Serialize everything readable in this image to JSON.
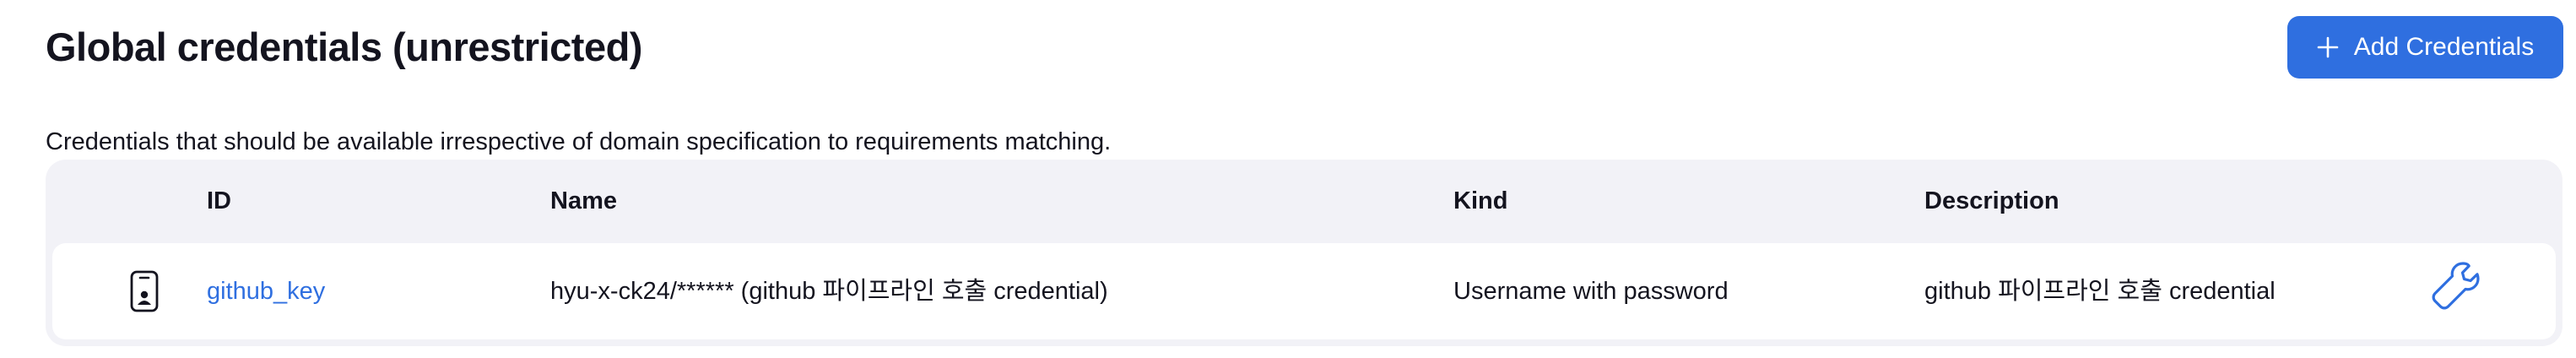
{
  "page": {
    "title": "Global credentials (unrestricted)",
    "description": "Credentials that should be available irrespective of domain specification to requirements matching."
  },
  "actions": {
    "add_credentials_label": "Add Credentials",
    "add_icon": "plus-icon"
  },
  "table": {
    "columns": {
      "id": "ID",
      "name": "Name",
      "kind": "Kind",
      "description": "Description"
    },
    "rows": [
      {
        "icon": "credential-card-icon",
        "id": "github_key",
        "name": "hyu-x-ck24/****** (github 파이프라인 호출 credential)",
        "kind": "Username with password",
        "description": "github 파이프라인 호출 credential",
        "action_icon": "wrench-icon"
      }
    ]
  },
  "colors": {
    "accent": "#2f6fe0",
    "table_background": "#f2f2f7",
    "text": "#14141f"
  }
}
